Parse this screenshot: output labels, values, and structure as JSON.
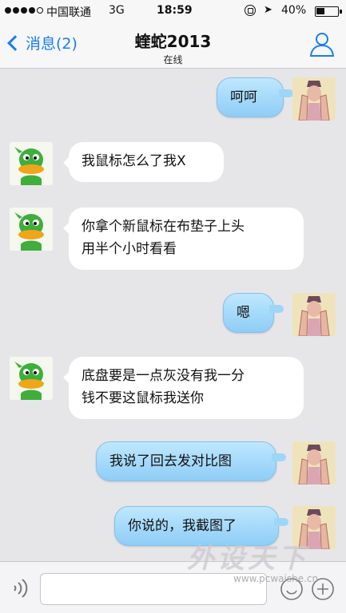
{
  "status_bar": {
    "carrier": "中国联通",
    "network": "3G",
    "time": "18:59",
    "battery": "40%",
    "battery_level": 0.4,
    "signal_bars": 4,
    "signal_total": 5
  },
  "nav": {
    "back_label": "消息(2)",
    "title": "蝰蛇2013",
    "subtitle": "在线",
    "accent_color": "#1a7cf5"
  },
  "messages": [
    {
      "from": "self",
      "text": "呵呵"
    },
    {
      "from": "other",
      "text": "我鼠标怎么了我X"
    },
    {
      "from": "other",
      "text": "你拿个新鼠标在布垫子上头\n用半个小时看看"
    },
    {
      "from": "self",
      "text": "嗯"
    },
    {
      "from": "other",
      "text": "底盘要是一点灰没有我一分\n钱不要这鼠标我送你"
    },
    {
      "from": "self",
      "text": "我说了回去发对比图"
    },
    {
      "from": "self",
      "text": "你说的，我截图了"
    }
  ],
  "input": {
    "value": "",
    "placeholder": ""
  },
  "watermark": {
    "brand": "外设天下",
    "url": "www.pcwaishe.cn"
  }
}
